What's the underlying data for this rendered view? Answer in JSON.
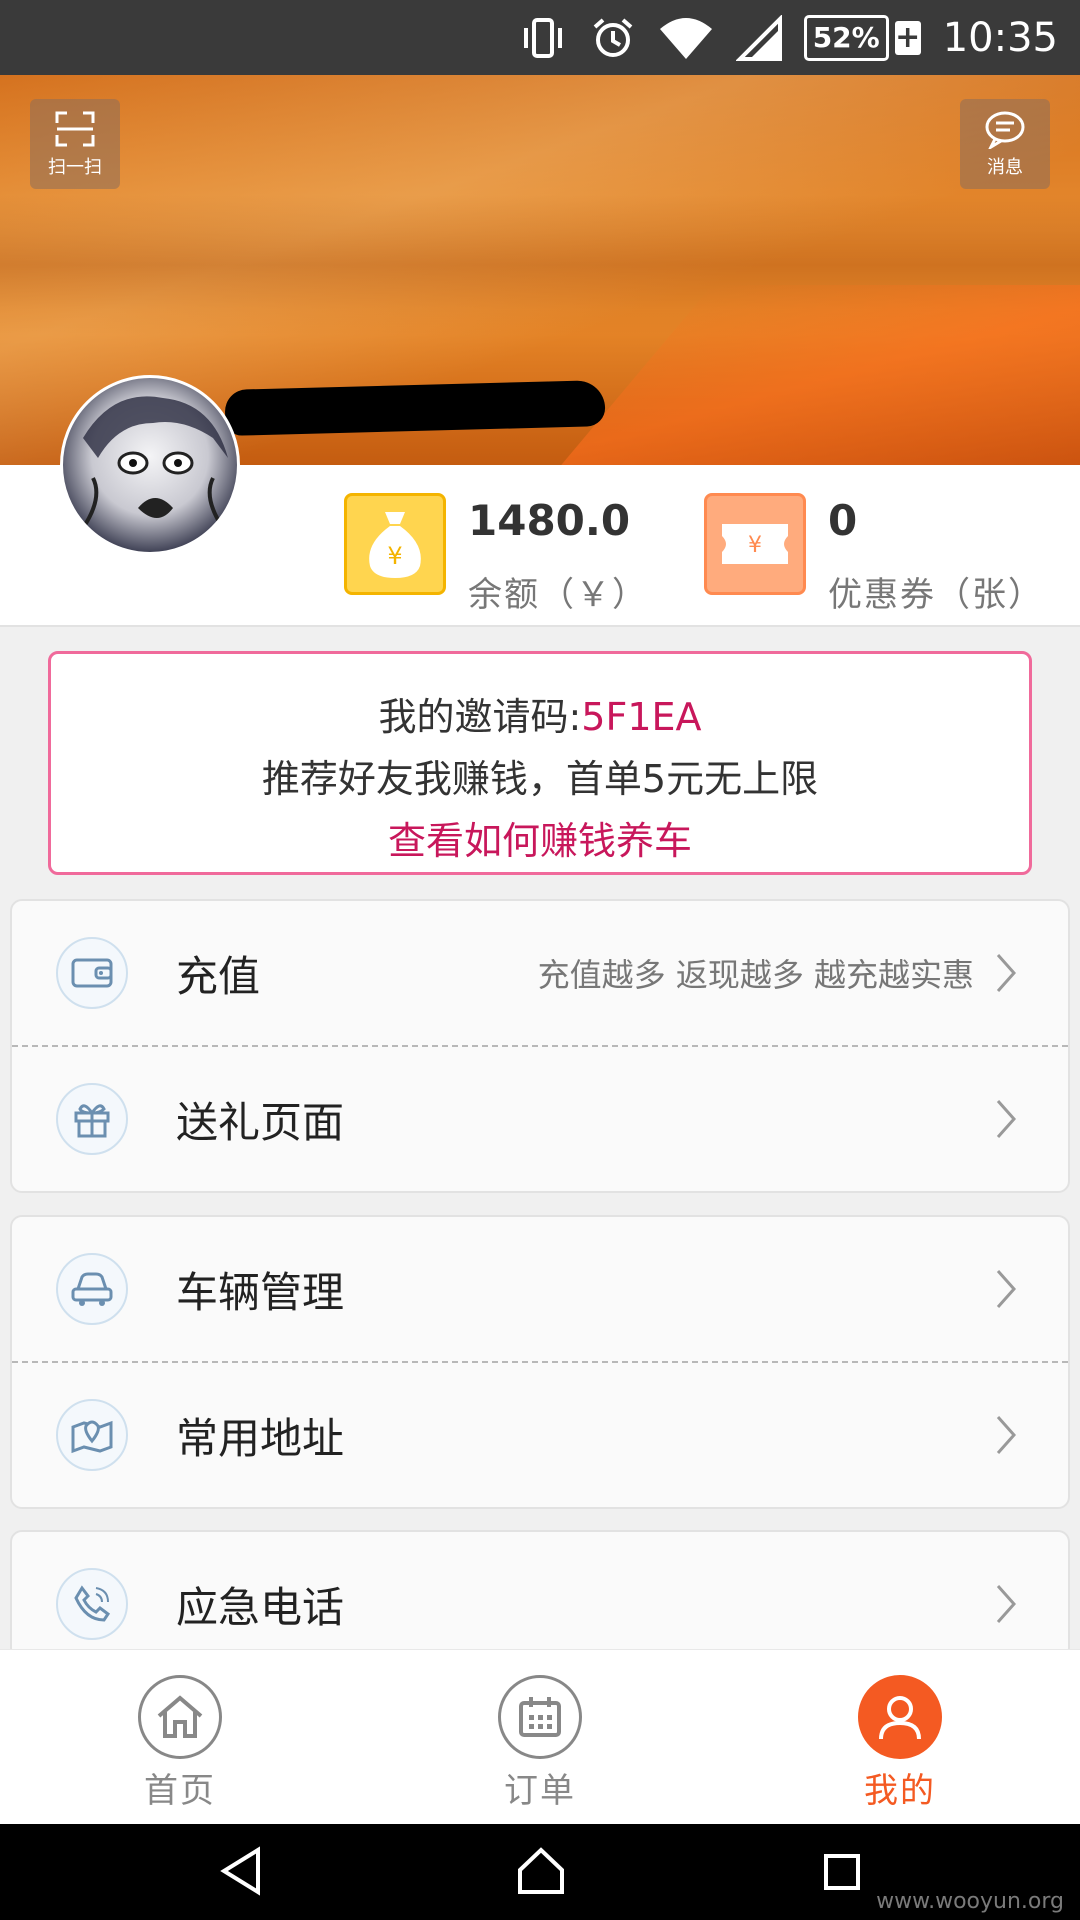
{
  "status_bar": {
    "battery_percent": "52%",
    "battery_charging_symbol": "+",
    "time": "10:35",
    "icons": [
      "vibrate-icon",
      "alarm-icon",
      "wifi-icon",
      "signal-icon",
      "battery-icon"
    ]
  },
  "header": {
    "scan_label": "扫一扫",
    "message_label": "消息",
    "username_redacted": true,
    "colors": {
      "banner_top": "#d5721f",
      "banner_bottom": "#c45c10"
    }
  },
  "stats": {
    "balance": {
      "value": "1480.0",
      "label": "余额（￥）",
      "icon": "money-bag-icon",
      "color": "#ffd54f"
    },
    "coupons": {
      "value": "0",
      "label": "优惠券（张）",
      "icon": "coupon-icon",
      "color": "#ffab7d"
    }
  },
  "invite": {
    "code_prefix": "我的邀请码:",
    "code": "5F1EA",
    "promo": "推荐好友我赚钱，首单5元无上限",
    "link": "查看如何赚钱养车",
    "accent_color": "#c8175b"
  },
  "menu": {
    "recharge": {
      "label": "充值",
      "hint": "充值越多 返现越多 越充越实惠",
      "icon": "wallet-icon"
    },
    "gift": {
      "label": "送礼页面",
      "icon": "gift-icon"
    },
    "vehicle": {
      "label": "车辆管理",
      "icon": "car-icon"
    },
    "address": {
      "label": "常用地址",
      "icon": "map-pin-icon"
    },
    "emergency": {
      "label": "应急电话",
      "icon": "phone-icon"
    }
  },
  "tabs": [
    {
      "label": "首页",
      "icon": "home-icon",
      "active": false
    },
    {
      "label": "订单",
      "icon": "calendar-icon",
      "active": false
    },
    {
      "label": "我的",
      "icon": "user-icon",
      "active": true
    }
  ],
  "active_color": "#f45a22",
  "watermark": "www.wooyun.org"
}
